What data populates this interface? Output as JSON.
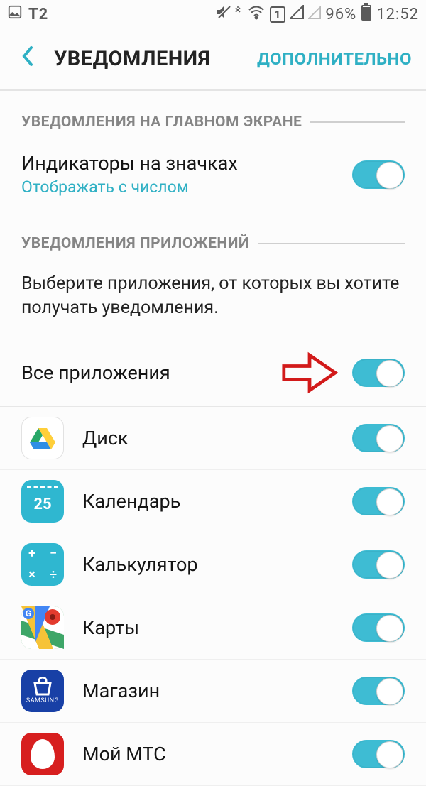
{
  "status": {
    "carrier": "T2",
    "battery": "96%",
    "time": "12:52",
    "sim": "1"
  },
  "header": {
    "title": "УВЕДОМЛЕНИЯ",
    "extra": "ДОПОЛНИТЕЛЬНО"
  },
  "section1": {
    "title": "УВЕДОМЛЕНИЯ НА ГЛАВНОМ ЭКРАНЕ",
    "item": {
      "title": "Индикаторы на значках",
      "subtitle": "Отображать с числом"
    }
  },
  "section2": {
    "title": "УВЕДОМЛЕНИЯ ПРИЛОЖЕНИЙ",
    "description": "Выберите приложения, от которых вы хотите получать уведомления.",
    "master": "Все приложения"
  },
  "apps": [
    {
      "name": "Диск",
      "icon": "drive"
    },
    {
      "name": "Календарь",
      "icon": "calendar",
      "badge": "25"
    },
    {
      "name": "Калькулятор",
      "icon": "calc"
    },
    {
      "name": "Карты",
      "icon": "maps"
    },
    {
      "name": "Магазин",
      "icon": "store",
      "badge": "SAMSUNG"
    },
    {
      "name": "Мой МТС",
      "icon": "mts"
    }
  ]
}
